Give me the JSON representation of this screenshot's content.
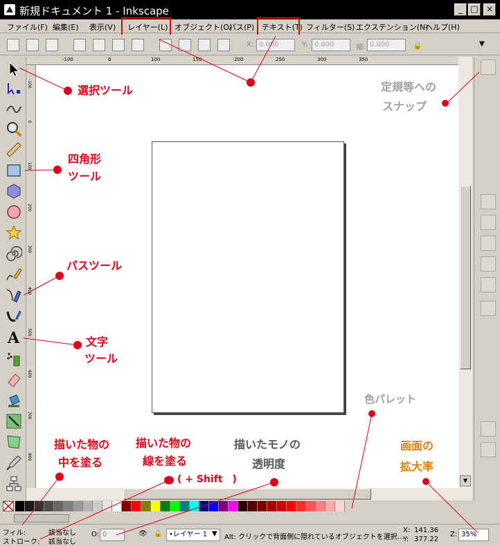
{
  "window": {
    "title": "新規ドキュメント 1 - Inkscape",
    "buttons": [
      "_",
      "□",
      "×"
    ]
  },
  "menu": [
    "ファイル(F)",
    "編集(E)",
    "表示(V)",
    "レイヤー(L)",
    "オブジェクト(O)",
    "パス(P)",
    "テキスト(T)",
    "フィルター(S)",
    "エクステンション(N)",
    "ヘルプ(H)"
  ],
  "toolbar": {
    "x_label": "X:",
    "x_value": "0.000",
    "y_label": "Y:",
    "y_value": "0.000",
    "w_label": "幅:",
    "w_value": "0.000"
  },
  "ruler": {
    "h_ticks": [
      "-100",
      "0",
      "100",
      "150",
      "200",
      "250",
      "300",
      "350"
    ],
    "v_ticks": [
      "-100",
      "0",
      "100",
      "200",
      "300",
      "400",
      "500",
      "600",
      "700",
      "800"
    ]
  },
  "annotations": {
    "select_tool": "選択ツール",
    "rect_tool_1": "四角形",
    "rect_tool_2": "ツール",
    "path_tool": "パスツール",
    "text_tool_1": "文字",
    "text_tool_2": "ツール",
    "snap_1": "定規等への",
    "snap_2": "スナップ",
    "palette": "色パレット",
    "fill_1": "描いた物の",
    "fill_2": "中を塗る",
    "stroke_1": "描いた物の",
    "stroke_2": "線を塗る",
    "shift": "( + Shift　)",
    "opacity_1": "描いたモノの",
    "opacity_2": "透明度",
    "zoom_1": "画面の",
    "zoom_2": "拡大率"
  },
  "status": {
    "fill_label": "フィル:",
    "fill_value": "該当なし",
    "stroke_label": "ストローク:",
    "stroke_value": "該当なし",
    "opacity_label": "O:",
    "opacity_value": "0",
    "layer_value": "•レイヤー 1",
    "message": "Alt: クリックで背面側に隠れているオブジェクトを選択…",
    "x_label": "X:",
    "x_value": "141.36",
    "y_label": "Y:",
    "y_value": "377.22",
    "zoom_label": "Z:",
    "zoom_value": "35%"
  },
  "colors": {
    "annotation_red": "#e0001a",
    "annotation_orange": "#e07f00",
    "annotation_gray": "#a0a0a0",
    "palette": [
      "#000000",
      "#1a1a1a",
      "#333333",
      "#4d4d4d",
      "#666666",
      "#808080",
      "#999999",
      "#b3b3b3",
      "#cccccc",
      "#e6e6e6",
      "#ffffff",
      "#800000",
      "#ff0000",
      "#808000",
      "#ffff00",
      "#008000",
      "#00ff00",
      "#008080",
      "#00ffff",
      "#000080",
      "#0000ff",
      "#800080",
      "#ff00ff",
      "#2b0000",
      "#550000",
      "#800000",
      "#aa0000",
      "#d40000",
      "#ff0000",
      "#ff2a2a",
      "#ff5555",
      "#ff8080",
      "#ffaaaa",
      "#ffd5d5"
    ]
  }
}
